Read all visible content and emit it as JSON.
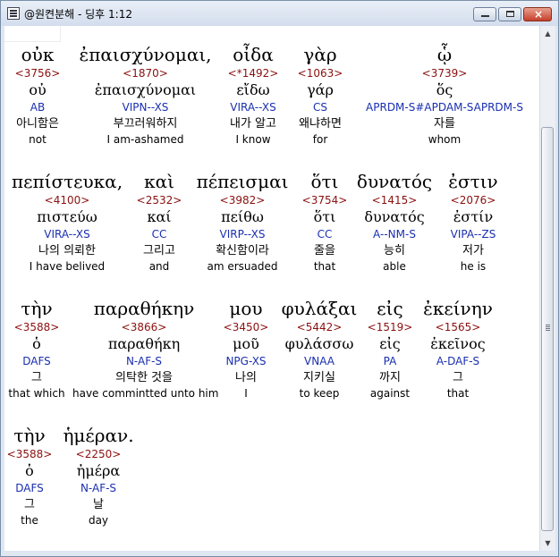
{
  "window": {
    "title": "@원켠분해 - 딩후 1:12"
  },
  "rows": [
    [
      {
        "greek": "οὐκ",
        "strong": "<3756>",
        "lemma": "οὐ",
        "morph": "AB",
        "korean": "아니함은",
        "english": "not"
      },
      {
        "greek": "ἐπαισχύνομαι,",
        "strong": "<1870>",
        "lemma": "ἐπαισχύνομαι",
        "morph": "VIPN--XS",
        "korean": "부끄러워하지",
        "english": "I am-ashamed"
      },
      {
        "greek": "οἶδα",
        "strong": "<*1492>",
        "lemma": "εἴδω",
        "morph": "VIRA--XS",
        "korean": "내가 알고",
        "english": "I know"
      },
      {
        "greek": "γὰρ",
        "strong": "<1063>",
        "lemma": "γάρ",
        "morph": "CS",
        "korean": "왜냐하면",
        "english": "for"
      },
      {
        "greek": "ᾧ",
        "strong": "<3739>",
        "lemma": "ὅς",
        "morph": "APRDM-S#APDAM-SAPRDM-S",
        "korean": "자를",
        "english": "whom"
      }
    ],
    [
      {
        "greek": "πεπίστευκα,",
        "strong": "<4100>",
        "lemma": "πιστεύω",
        "morph": "VIRA--XS",
        "korean": "나의 의뢰한",
        "english": "I have belived"
      },
      {
        "greek": "καὶ",
        "strong": "<2532>",
        "lemma": "καί",
        "morph": "CC",
        "korean": "그리고",
        "english": "and"
      },
      {
        "greek": "πέπεισμαι",
        "strong": "<3982>",
        "lemma": "πείθω",
        "morph": "VIRP--XS",
        "korean": "확신함이라",
        "english": "am ersuaded"
      },
      {
        "greek": "ὅτι",
        "strong": "<3754>",
        "lemma": "ὅτι",
        "morph": "CC",
        "korean": "줄을",
        "english": "that"
      },
      {
        "greek": "δυνατός",
        "strong": "<1415>",
        "lemma": "δυνατός",
        "morph": "A--NM-S",
        "korean": "능히",
        "english": "able"
      },
      {
        "greek": "ἐστιν",
        "strong": "<2076>",
        "lemma": "ἐστίν",
        "morph": "VIPA--ZS",
        "korean": "저가",
        "english": "he is"
      }
    ],
    [
      {
        "greek": "τὴν",
        "strong": "<3588>",
        "lemma": "ὁ",
        "morph": "DAFS",
        "korean": "그",
        "english": "that which"
      },
      {
        "greek": "παραθήκην",
        "strong": "<3866>",
        "lemma": "παραθήκη",
        "morph": "N-AF-S",
        "korean": "의탁한 것을",
        "english": "have commintted unto him"
      },
      {
        "greek": "μου",
        "strong": "<3450>",
        "lemma": "μοῦ",
        "morph": "NPG-XS",
        "korean": "나의",
        "english": "I"
      },
      {
        "greek": "φυλάξαι",
        "strong": "<5442>",
        "lemma": "φυλάσσω",
        "morph": "VNAA",
        "korean": "지키실",
        "english": "to keep"
      },
      {
        "greek": "εἰς",
        "strong": "<1519>",
        "lemma": "εἰς",
        "morph": "PA",
        "korean": "까지",
        "english": "against"
      },
      {
        "greek": "ἐκείνην",
        "strong": "<1565>",
        "lemma": "ἐκεῖνος",
        "morph": "A-DAF-S",
        "korean": "그",
        "english": "that"
      }
    ],
    [
      {
        "greek": "τὴν",
        "strong": "<3588>",
        "lemma": "ὁ",
        "morph": "DAFS",
        "korean": "그",
        "english": "the"
      },
      {
        "greek": "ἡμέραν.",
        "strong": "<2250>",
        "lemma": "ἡμέρα",
        "morph": "N-AF-S",
        "korean": "날",
        "english": "day"
      }
    ]
  ],
  "colors": {
    "strong": "#8b1010",
    "morph": "#1a2fb0",
    "text": "#000000"
  },
  "icons": {
    "app": "document-icon",
    "minimize": "minimize-icon",
    "maximize": "maximize-icon",
    "close": "close-icon",
    "scroll_up": "arrow-up-icon",
    "scroll_down": "arrow-down-icon"
  }
}
